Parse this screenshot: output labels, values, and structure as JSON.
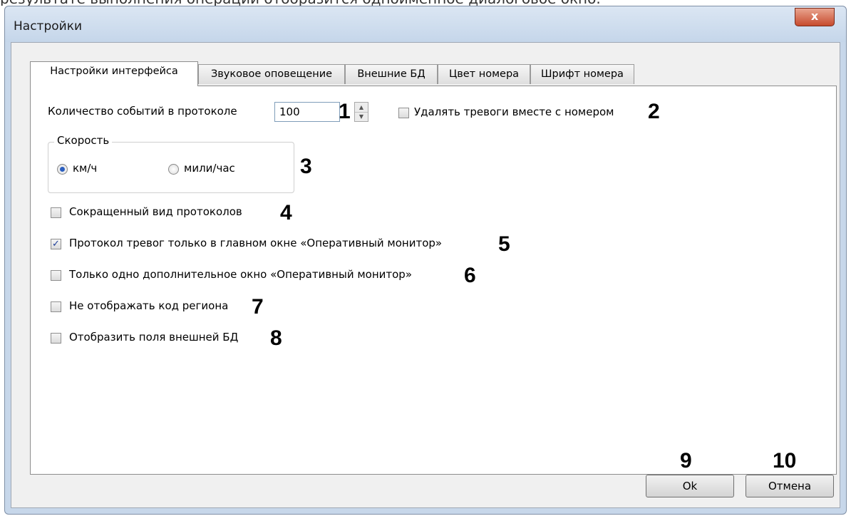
{
  "document_caption": "результате выполнения операции отобразится одноимённое диалоговое окно.",
  "window": {
    "title": "Настройки",
    "close_glyph": "x"
  },
  "tabs": [
    {
      "label": "Настройки интерфейса",
      "active": true
    },
    {
      "label": "Звуковое оповещение",
      "active": false
    },
    {
      "label": "Внешние БД",
      "active": false
    },
    {
      "label": "Цвет номера",
      "active": false
    },
    {
      "label": "Шрифт номера",
      "active": false
    }
  ],
  "settings": {
    "events_count_label": "Количество событий в протоколе",
    "events_count_value": "100",
    "delete_alarms_label": "Удалять тревоги вместе с номером",
    "delete_alarms_checked": false,
    "speed_group_label": "Скорость",
    "speed_options": [
      {
        "label": "км/ч",
        "selected": true
      },
      {
        "label": "мили/час",
        "selected": false
      }
    ],
    "checkboxes": [
      {
        "label": "Сокращенный вид протоколов",
        "checked": false
      },
      {
        "label": "Протокол тревог только в главном окне «Оперативный монитор»",
        "checked": true
      },
      {
        "label": "Только одно дополнительное окно «Оперативный монитор»",
        "checked": false
      },
      {
        "label": "Не отображать код региона",
        "checked": false
      },
      {
        "label": "Отобразить поля внешней БД",
        "checked": false
      }
    ]
  },
  "buttons": {
    "ok_label": "Ok",
    "cancel_label": "Отмена"
  },
  "callouts": [
    "1",
    "2",
    "3",
    "4",
    "5",
    "6",
    "7",
    "8",
    "9",
    "10"
  ],
  "icons": {
    "checkmark": "✓",
    "spin_up": "▲",
    "spin_down": "▼"
  }
}
